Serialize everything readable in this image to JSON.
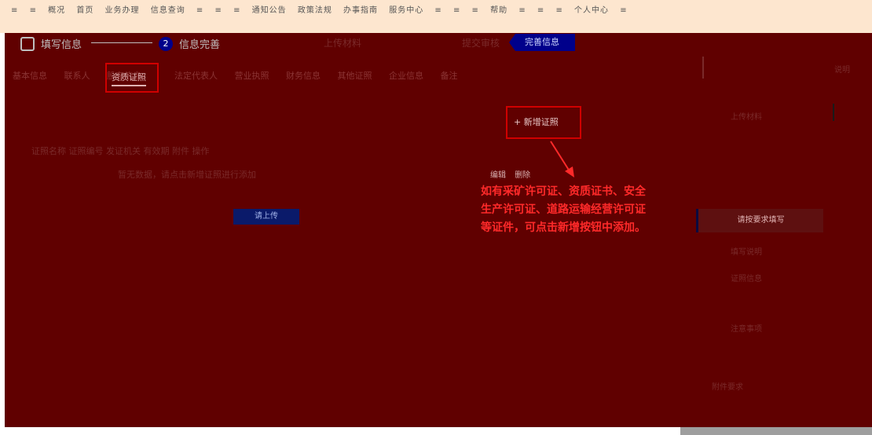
{
  "top_nav": {
    "items": [
      "≡",
      "≡",
      "概况",
      "首页",
      "业务办理",
      "信息查询",
      "≡",
      "≡",
      "≡",
      "通知公告",
      "政策法规",
      "办事指南",
      "服务中心",
      "≡",
      "≡",
      "≡",
      "帮助",
      "≡",
      "≡",
      "≡",
      "个人中心",
      "≡"
    ]
  },
  "stepper": {
    "step1_label": "填写信息",
    "step2_label": "信息完善",
    "step3_label": "上传材料",
    "step4_label": "提交审核"
  },
  "top_button_label": "完善信息",
  "tabs": {
    "items": [
      "基本信息",
      "联系人",
      "股东信息"
    ],
    "active_label": "资质证照",
    "items_after": [
      "法定代表人",
      "营业执照",
      "财务信息",
      "其他证照",
      "企业信息",
      "备注"
    ]
  },
  "add_button_label": "+ 新增证照",
  "upload_button_label": "请上传",
  "faint_texts": {
    "row1": "证照名称    证照编号    发证机关    有效期    附件    操作",
    "row2": "暂无数据，请点击新增证照进行添加"
  },
  "row_links": [
    "编辑",
    "删除"
  ],
  "annotation": "如有采矿许可证、资质证书、安全生产许可证、道路运输经营许可证等证件，可点击新增按钮中添加。",
  "right_panel": {
    "card_label": "请按要求填写",
    "texts": [
      "说明",
      "上传材料",
      "填写说明",
      "证照信息",
      "注意事项",
      "附件要求"
    ]
  },
  "colors": {
    "overlay": "#600000",
    "highlight_border": "#d00000",
    "annotation_text": "#ff2a2a",
    "accent_blue": "#00008b"
  }
}
